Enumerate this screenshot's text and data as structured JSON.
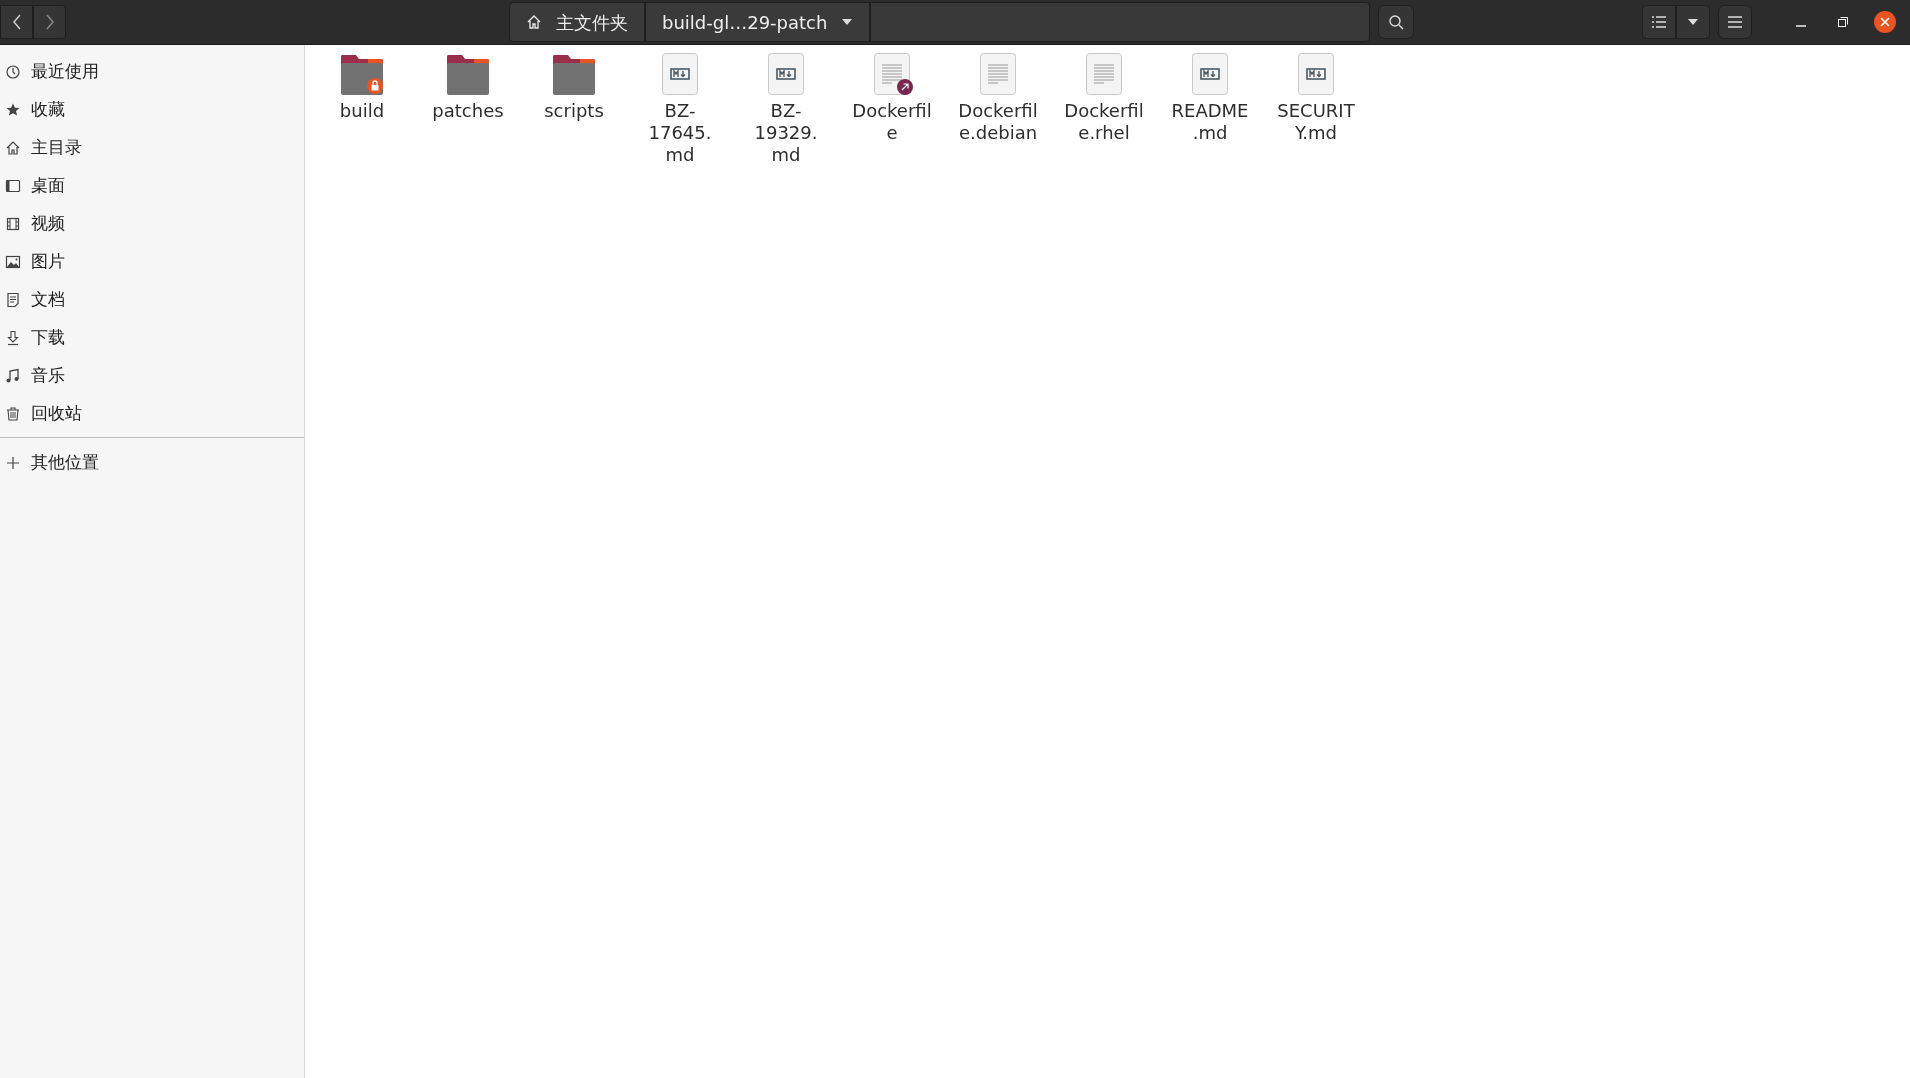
{
  "header": {
    "path": [
      {
        "kind": "home",
        "label": "主文件夹"
      },
      {
        "kind": "current",
        "label": "build-gl…29-patch"
      }
    ]
  },
  "sidebar": {
    "items": [
      {
        "kind": "recent",
        "label": "最近使用",
        "selected": false
      },
      {
        "kind": "star",
        "label": "收藏",
        "selected": false
      },
      {
        "kind": "home",
        "label": "主目录",
        "selected": false
      },
      {
        "kind": "desktop",
        "label": "桌面",
        "selected": false
      },
      {
        "kind": "video",
        "label": "视频",
        "selected": false
      },
      {
        "kind": "picture",
        "label": "图片",
        "selected": false
      },
      {
        "kind": "document",
        "label": "文档",
        "selected": false
      },
      {
        "kind": "download",
        "label": "下载",
        "selected": false
      },
      {
        "kind": "music",
        "label": "音乐",
        "selected": false
      },
      {
        "kind": "trash",
        "label": "回收站",
        "selected": false
      }
    ],
    "other": {
      "kind": "plus",
      "label": "其他位置"
    }
  },
  "files": [
    {
      "kind": "locked_folder",
      "name_lines": [
        "build"
      ]
    },
    {
      "kind": "folder",
      "name_lines": [
        "patches"
      ]
    },
    {
      "kind": "folder",
      "name_lines": [
        "scripts"
      ]
    },
    {
      "kind": "markdown",
      "name_lines": [
        "BZ-",
        "17645.",
        "md"
      ]
    },
    {
      "kind": "markdown",
      "name_lines": [
        "BZ-",
        "19329.",
        "md"
      ]
    },
    {
      "kind": "linked_text",
      "name_lines": [
        "Dockerfil",
        "e"
      ]
    },
    {
      "kind": "text",
      "name_lines": [
        "Dockerfil",
        "e.debian"
      ]
    },
    {
      "kind": "text",
      "name_lines": [
        "Dockerfil",
        "e.rhel"
      ]
    },
    {
      "kind": "markdown",
      "name_lines": [
        "README",
        ".md"
      ]
    },
    {
      "kind": "markdown",
      "name_lines": [
        "SECURIT",
        "Y.md"
      ]
    }
  ]
}
